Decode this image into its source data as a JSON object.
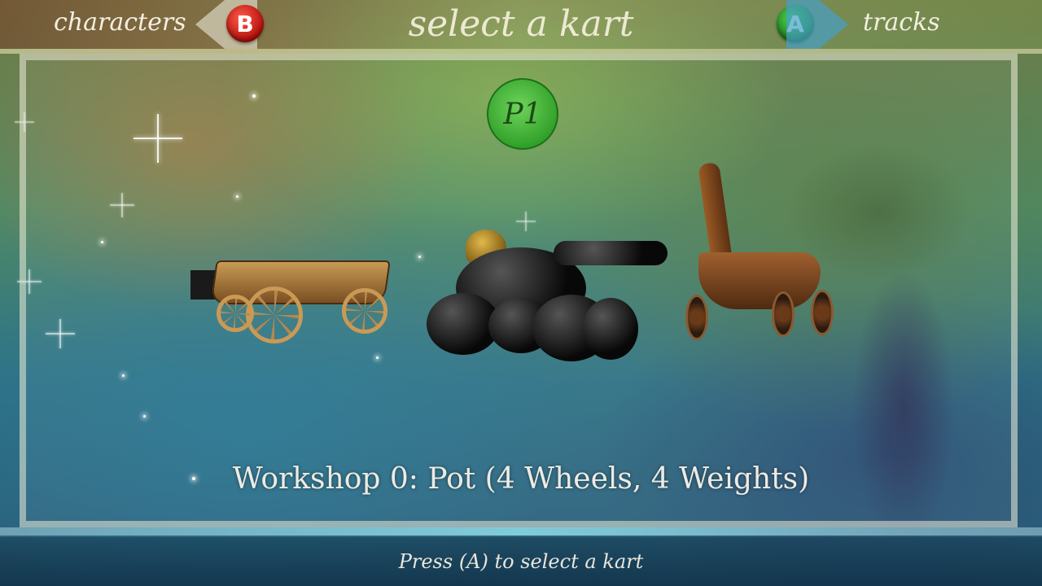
{
  "header": {
    "back_label": "characters",
    "back_button": "B",
    "title": "select a kart",
    "next_button": "A",
    "next_label": "tracks"
  },
  "player": {
    "badge": "P1",
    "color": "#3aa52f"
  },
  "karts": [
    {
      "name": "wagon-kart"
    },
    {
      "name": "pot-kart",
      "selected": true
    },
    {
      "name": "viking-boat-kart"
    }
  ],
  "selection": {
    "label": "Workshop 0: Pot (4 Wheels, 4 Weights)"
  },
  "footer": {
    "hint": "Press (A) to select a kart"
  },
  "colors": {
    "b_button": "#c8140e",
    "a_button": "#2c9a25"
  }
}
